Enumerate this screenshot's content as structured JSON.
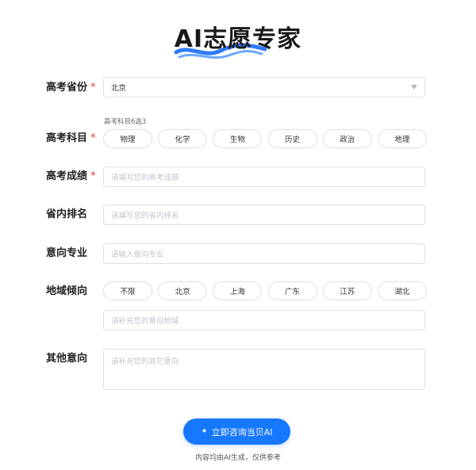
{
  "header": {
    "title": "AI志愿专家",
    "swoosh_color": "#2f7bf5"
  },
  "form": {
    "province": {
      "label": "高考省份",
      "required_mark": "*",
      "value": "北京"
    },
    "subjects": {
      "label": "高考科目",
      "required_mark": "*",
      "hint": "高考科目6选3",
      "options": [
        "物理",
        "化学",
        "生物",
        "历史",
        "政治",
        "地理"
      ]
    },
    "score": {
      "label": "高考成绩",
      "required_mark": "*",
      "placeholder": "请填写您的高考成绩"
    },
    "rank": {
      "label": "省内排名",
      "placeholder": "请填写您的省内排名"
    },
    "major": {
      "label": "意向专业",
      "placeholder": "请输入意向专业"
    },
    "region": {
      "label": "地域倾向",
      "options": [
        "不限",
        "北京",
        "上海",
        "广东",
        "江苏",
        "湖北"
      ],
      "extra_placeholder": "请补充您的意向地域"
    },
    "other": {
      "label": "其他意向",
      "placeholder": "请补充您的其它意向"
    }
  },
  "submit": {
    "label": "立即咨询当贝AI",
    "icon": "sparkle-icon",
    "color": "#1677ff"
  },
  "footnote": "内容均由AI生成，仅供参考"
}
